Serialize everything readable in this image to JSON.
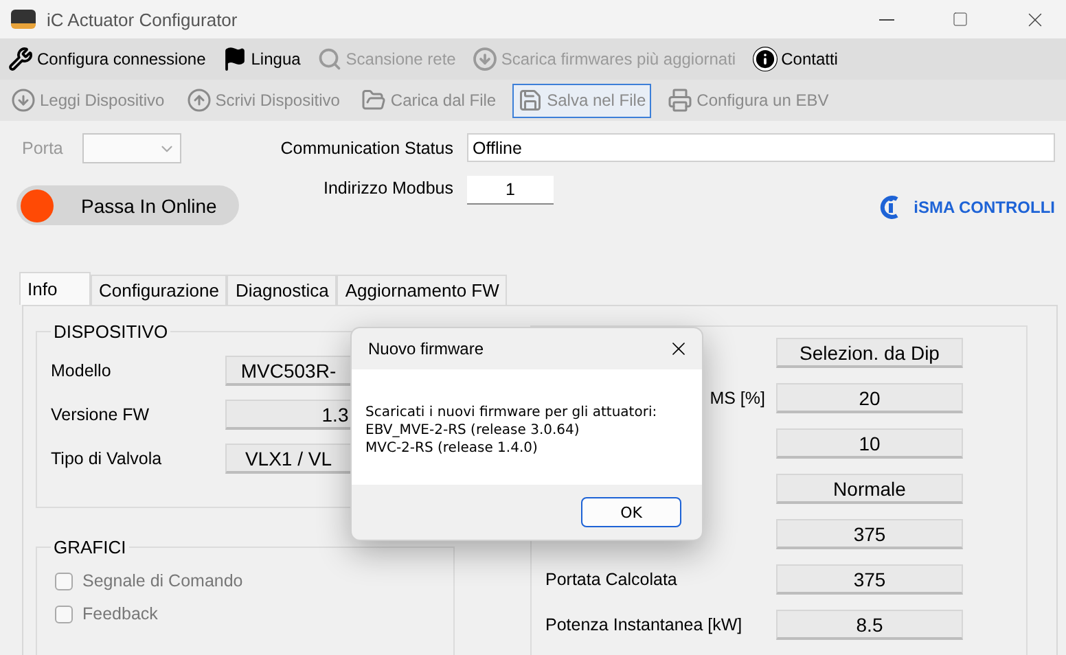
{
  "window": {
    "title": "iC Actuator Configurator"
  },
  "menu": [
    {
      "label": "Configura connessione",
      "disabled": false
    },
    {
      "label": "Lingua",
      "disabled": false
    },
    {
      "label": "Scansione rete",
      "disabled": true
    },
    {
      "label": "Scarica firmwares più aggiornati",
      "disabled": true
    },
    {
      "label": "Contatti",
      "disabled": false
    }
  ],
  "toolbar": [
    {
      "label": "Leggi Dispositivo",
      "disabled": true,
      "selected": false
    },
    {
      "label": "Scrivi Dispositivo",
      "disabled": true,
      "selected": false
    },
    {
      "label": "Carica dal File",
      "disabled": true,
      "selected": false
    },
    {
      "label": "Salva nel File",
      "disabled": true,
      "selected": true
    },
    {
      "label": "Configura un EBV",
      "disabled": true,
      "selected": false
    }
  ],
  "porta": {
    "label": "Porta",
    "disabled": true
  },
  "communication_status": {
    "label": "Communication Status",
    "value": "Offline"
  },
  "modbus": {
    "label": "Indirizzo Modbus",
    "value": "1"
  },
  "online_toggle": {
    "label": "Passa In Online",
    "on": false
  },
  "logo": {
    "text": "iSMA CONTROLLI"
  },
  "tabs": [
    {
      "label": "Info",
      "selected": true
    },
    {
      "label": "Configurazione",
      "selected": false
    },
    {
      "label": "Diagnostica",
      "selected": false
    },
    {
      "label": "Aggiornamento FW",
      "selected": false
    }
  ],
  "dispositivo": {
    "title": "DISPOSITIVO",
    "rows": [
      {
        "label": "Modello",
        "value": "MVC503R-"
      },
      {
        "label": "Versione FW",
        "value": "1.3"
      },
      {
        "label": "Tipo di Valvola",
        "value": "VLX1 / VL"
      }
    ]
  },
  "grafici": {
    "title": "GRAFICI",
    "items": [
      {
        "label": "Segnale di Comando",
        "checked": false
      },
      {
        "label": "Feedback",
        "checked": false
      }
    ]
  },
  "stato": {
    "rows": [
      {
        "value": "Selezion. da Dip"
      },
      {
        "label": "MS [%]",
        "value": "20"
      },
      {
        "value": "10"
      },
      {
        "value": "Normale"
      },
      {
        "value": "375"
      },
      {
        "label": "Portata Calcolata",
        "value": "375"
      },
      {
        "label": "Potenza Instantanea [kW]",
        "value": "8.5"
      }
    ]
  },
  "dialog": {
    "title": "Nuovo firmware",
    "message": [
      "Scaricati i nuovi firmware per gli attuatori:",
      "EBV_MVE-2-RS (release 3.0.64)",
      "MVC-2-RS (release 1.4.0)"
    ],
    "button": "OK"
  }
}
